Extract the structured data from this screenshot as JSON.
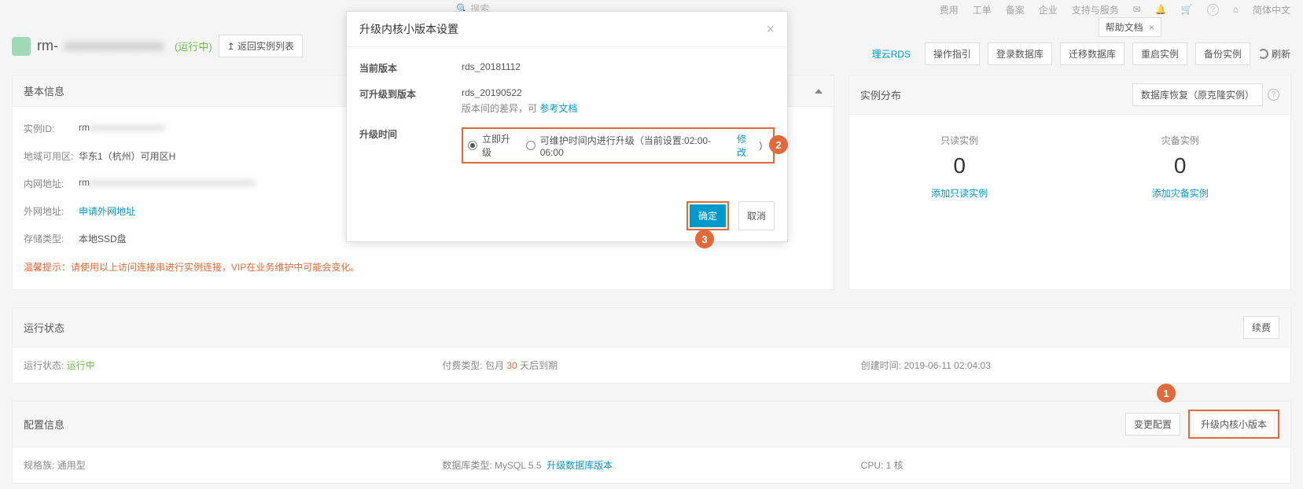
{
  "topnav": {
    "search_placeholder": "搜索",
    "items": [
      "费用",
      "工单",
      "备案",
      "企业",
      "支持与服务"
    ],
    "lang": "简体中文",
    "help_tip": "帮助文档"
  },
  "header": {
    "prefix": "rm-",
    "status": "(运行中)",
    "back_button": "↥ 返回实例列表"
  },
  "actions": {
    "link1": "理云RDS",
    "b1": "操作指引",
    "b2": "登录数据库",
    "b3": "迁移数据库",
    "b4": "重启实例",
    "b5": "备份实例",
    "refresh": "刷新"
  },
  "basic": {
    "title": "基本信息",
    "id_k": "实例ID:",
    "id_v": "rm",
    "region_k": "地域可用区:",
    "region_v": "华东1（杭州）可用区H",
    "intranet_k": "内网地址:",
    "intranet_v": "rm",
    "internet_k": "外网地址:",
    "internet_v": "申请外网地址",
    "storage_k": "存储类型:",
    "storage_v": "本地SSD盘",
    "warning": "温馨提示：请使用以上访问连接串进行实例连接，VIP在业务维护中可能会变化。"
  },
  "dist": {
    "title": "实例分布",
    "restore_btn": "数据库恢复（原克隆实例）",
    "read_lbl": "只读实例",
    "read_num": "0",
    "read_add": "添加只读实例",
    "dr_lbl": "灾备实例",
    "dr_num": "0",
    "dr_add": "添加灾备实例"
  },
  "runstatus": {
    "title": "运行状态",
    "renew": "续费",
    "status_k": "运行状态:",
    "status_v": "运行中",
    "pay_k": "付费类型:",
    "pay_v1": "包月",
    "pay_days": "30",
    "pay_v2": "天后到期",
    "create_k": "创建时间:",
    "create_v": "2019-06-11 02:04:03"
  },
  "configinfo": {
    "title": "配置信息",
    "change_btn": "变更配置",
    "upgrade_btn": "升级内核小版本",
    "spec_k": "规格族:",
    "spec_v": "通用型",
    "db_k": "数据库类型:",
    "db_v": "MySQL 5.5",
    "db_link": "升级数据库版本",
    "cpu_k": "CPU:",
    "cpu_v": "1 核"
  },
  "modal": {
    "title": "升级内核小版本设置",
    "cur_k": "当前版本",
    "cur_v": "rds_20181112",
    "new_k": "可升级到版本",
    "new_v": "rds_20190522",
    "new_sub": "版本间的差异，可",
    "new_link": "参考文档",
    "time_k": "升级时间",
    "opt1": "立即升级",
    "opt2": "可维护时间内进行升级（当前设置:02:00-06:00",
    "opt2_link": "修改",
    "opt2_end": "）",
    "confirm": "确定",
    "cancel": "取消"
  },
  "callouts": {
    "c1": "1",
    "c2": "2",
    "c3": "3"
  }
}
